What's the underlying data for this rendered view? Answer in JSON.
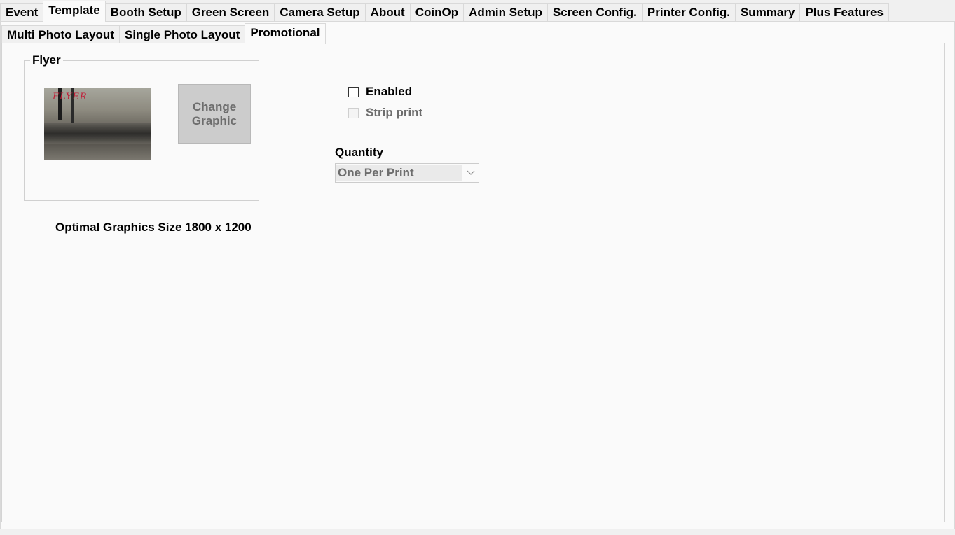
{
  "top_tabs": [
    {
      "label": "Event",
      "active": false
    },
    {
      "label": "Template",
      "active": true
    },
    {
      "label": "Booth Setup",
      "active": false
    },
    {
      "label": "Green Screen",
      "active": false
    },
    {
      "label": "Camera Setup",
      "active": false
    },
    {
      "label": "About",
      "active": false
    },
    {
      "label": "CoinOp",
      "active": false
    },
    {
      "label": "Admin Setup",
      "active": false
    },
    {
      "label": "Screen Config.",
      "active": false
    },
    {
      "label": "Printer Config.",
      "active": false
    },
    {
      "label": "Summary",
      "active": false
    },
    {
      "label": "Plus Features",
      "active": false
    }
  ],
  "sub_tabs": [
    {
      "label": "Multi Photo Layout",
      "active": false
    },
    {
      "label": "Single Photo Layout",
      "active": false
    },
    {
      "label": "Promotional",
      "active": true
    }
  ],
  "flyer": {
    "group_title": "Flyer",
    "preview_text": "FLYER",
    "change_button_label": "Change\nGraphic"
  },
  "optimal_size_label": "Optimal Graphics Size 1800 x 1200",
  "options": {
    "enabled_label": "Enabled",
    "enabled_checked": false,
    "strip_print_label": "Strip print",
    "strip_print_checked": false,
    "strip_print_disabled": true
  },
  "quantity": {
    "label": "Quantity",
    "selected": "One Per Print"
  }
}
